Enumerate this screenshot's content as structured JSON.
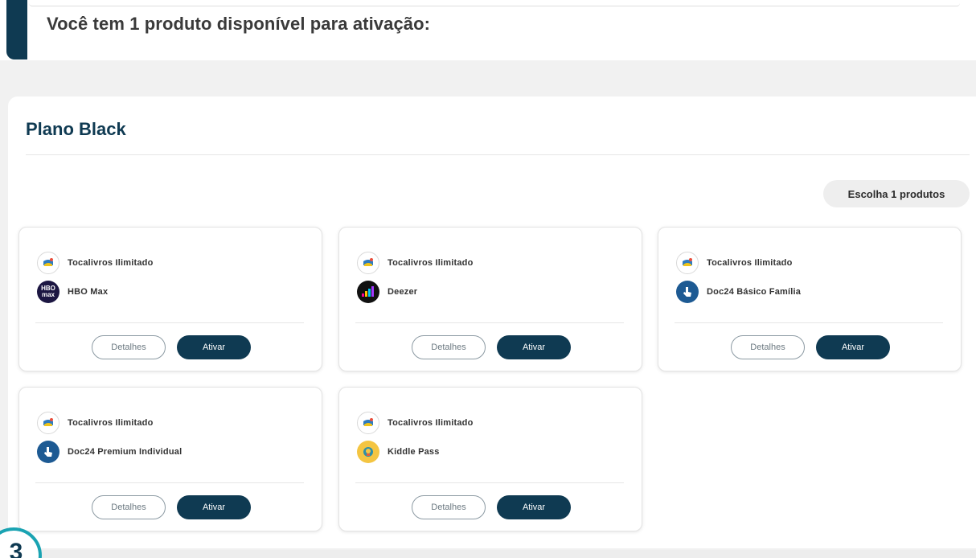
{
  "banner": {
    "title": "Você tem 1 produto disponível para ativação:"
  },
  "plan": {
    "title": "Plano Black",
    "choose_label": "Escolha 1 produtos"
  },
  "cards": [
    {
      "product1": "Tocalivros Ilimitado",
      "product2": "HBO Max",
      "details_label": "Detalhes",
      "activate_label": "Ativar"
    },
    {
      "product1": "Tocalivros Ilimitado",
      "product2": "Deezer",
      "details_label": "Detalhes",
      "activate_label": "Ativar"
    },
    {
      "product1": "Tocalivros Ilimitado",
      "product2": "Doc24 Básico Família",
      "details_label": "Detalhes",
      "activate_label": "Ativar"
    },
    {
      "product1": "Tocalivros Ilimitado",
      "product2": "Doc24 Premium Individual",
      "details_label": "Detalhes",
      "activate_label": "Ativar"
    },
    {
      "product1": "Tocalivros Ilimitado",
      "product2": "Kiddle Pass",
      "details_label": "Detalhes",
      "activate_label": "Ativar"
    }
  ],
  "icons": {
    "tocalivros": "tocalivros-icon",
    "hbo": "hbo-max-icon",
    "deezer": "deezer-icon",
    "doc24": "doc24-icon",
    "kiddle": "kiddle-pass-icon"
  },
  "hbo_icon_text": {
    "line1": "HBO",
    "line2": "max"
  },
  "step_badge": "3",
  "colors": {
    "primary": "#0f3a52",
    "accent": "#1aa3b2",
    "background": "#f1f1f1"
  }
}
